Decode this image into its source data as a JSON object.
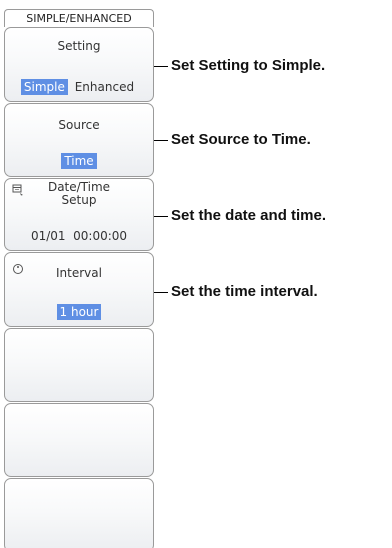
{
  "menu": {
    "title": "SIMPLE/ENHANCED",
    "keys": [
      {
        "title": "Setting",
        "options": [
          "Simple",
          "Enhanced"
        ],
        "selected": "Simple"
      },
      {
        "title": "Source",
        "value": "Time"
      },
      {
        "title_line1": "Date/Time",
        "title_line2": "Setup",
        "value": "01/01  00:00:00",
        "icon": "calendar-icon"
      },
      {
        "title": "Interval",
        "value": "1 hour",
        "icon": "jog-dial-icon"
      },
      {
        "title": ""
      },
      {
        "title": ""
      },
      {
        "title": ""
      }
    ]
  },
  "callouts": [
    "Set Setting to Simple.",
    "Set Source to Time.",
    "Set the date and time.",
    "Set the time interval."
  ],
  "colors": {
    "highlight": "#5f8fe4",
    "border": "#9a9a9a"
  }
}
